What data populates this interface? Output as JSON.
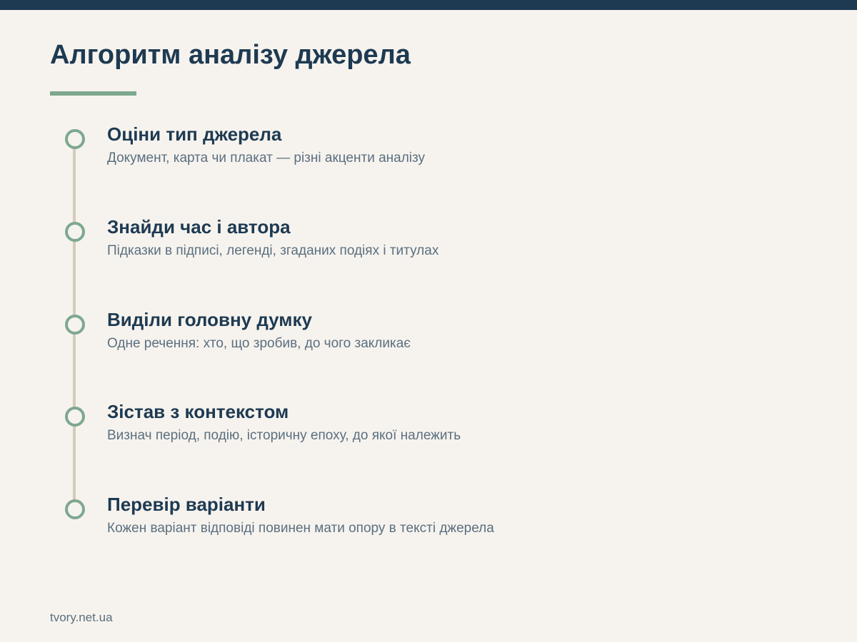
{
  "page": {
    "title": "Алгоритм аналізу джерела",
    "footer": "tvory.net.ua"
  },
  "colors": {
    "header_bar": "#1e3a52",
    "background": "#f6f3ee",
    "accent": "#7ea88f",
    "title_text": "#1e3a52",
    "body_text": "#5b6f80",
    "timeline": "#d3cbbd"
  },
  "steps": [
    {
      "title": "Оціни тип джерела",
      "description": "Документ, карта чи плакат — різні акценти аналізу"
    },
    {
      "title": "Знайди час і автора",
      "description": "Підказки в підписі, легенді, згаданих подіях і титулах"
    },
    {
      "title": "Виділи головну думку",
      "description": "Одне речення: хто, що зробив, до чого закликає"
    },
    {
      "title": "Зістав з контекстом",
      "description": "Визнач період, подію, історичну епоху, до якої належить"
    },
    {
      "title": "Перевір варіанти",
      "description": "Кожен варіант відповіді повинен мати опору в тексті джерела"
    }
  ]
}
